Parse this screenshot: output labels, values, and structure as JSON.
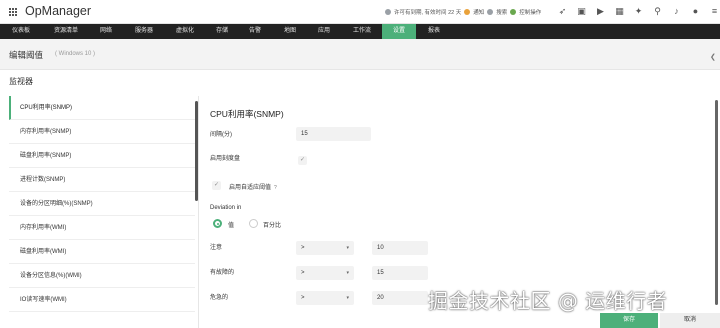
{
  "app": {
    "title": "OpManager"
  },
  "top_info": {
    "license": "许可有到期, 有效时间 22 天",
    "alerts": "通知",
    "search": "搜索",
    "tasks": "控制操作"
  },
  "top_icons": [
    "rocket-icon",
    "monitor-icon",
    "play-icon",
    "grid-icon",
    "gift-icon",
    "search-icon",
    "bell-icon",
    "user-icon",
    "menu-icon"
  ],
  "nav": {
    "items": [
      {
        "label": "仪表板"
      },
      {
        "label": "资源清单"
      },
      {
        "label": "网络"
      },
      {
        "label": "服务器"
      },
      {
        "label": "虚拟化"
      },
      {
        "label": "存储"
      },
      {
        "label": "告警"
      },
      {
        "label": "地图"
      },
      {
        "label": "应用"
      },
      {
        "label": "工作流"
      },
      {
        "label": "设置",
        "active": true
      },
      {
        "label": "报表"
      }
    ]
  },
  "page": {
    "title": "编辑阈值",
    "subtitle": "( Windows 10 )"
  },
  "section": {
    "label": "监视器"
  },
  "sidebar": {
    "items": [
      {
        "label": "CPU利用率(SNMP)",
        "active": true
      },
      {
        "label": "内存利用率(SNMP)"
      },
      {
        "label": "磁盘利用率(SNMP)"
      },
      {
        "label": "进程计数(SNMP)"
      },
      {
        "label": "设备的分区明细(%)(SNMP)"
      },
      {
        "label": "内存利用率(WMI)"
      },
      {
        "label": "磁盘利用率(WMI)"
      },
      {
        "label": "设备分区信息(%)(WMI)"
      },
      {
        "label": "IO读写速率(WMI)"
      }
    ]
  },
  "form": {
    "title": "CPU利用率(SNMP)",
    "interval_label": "间隔(分)",
    "interval_value": "15",
    "enable_gauge_label": "启用刻度盘",
    "enable_gauge_check": "✓",
    "adaptive_check": "✓",
    "adaptive_label": "启用自适应阈值",
    "adaptive_help": "?",
    "deviation_label": "Deviation in",
    "radio_value": "值",
    "radio_percent": "百分比",
    "rows": [
      {
        "label": "注意",
        "op": ">",
        "value": "10"
      },
      {
        "label": "有故障的",
        "op": ">",
        "value": "15"
      },
      {
        "label": "危急的",
        "op": ">",
        "value": "20"
      }
    ],
    "caret": "▾"
  },
  "buttons": {
    "save": "保存",
    "cancel": "取消"
  },
  "watermark": "掘金技术社区 @ 运维行者",
  "colors": {
    "accent": "#4cb07a",
    "nav_bg": "#222222"
  }
}
